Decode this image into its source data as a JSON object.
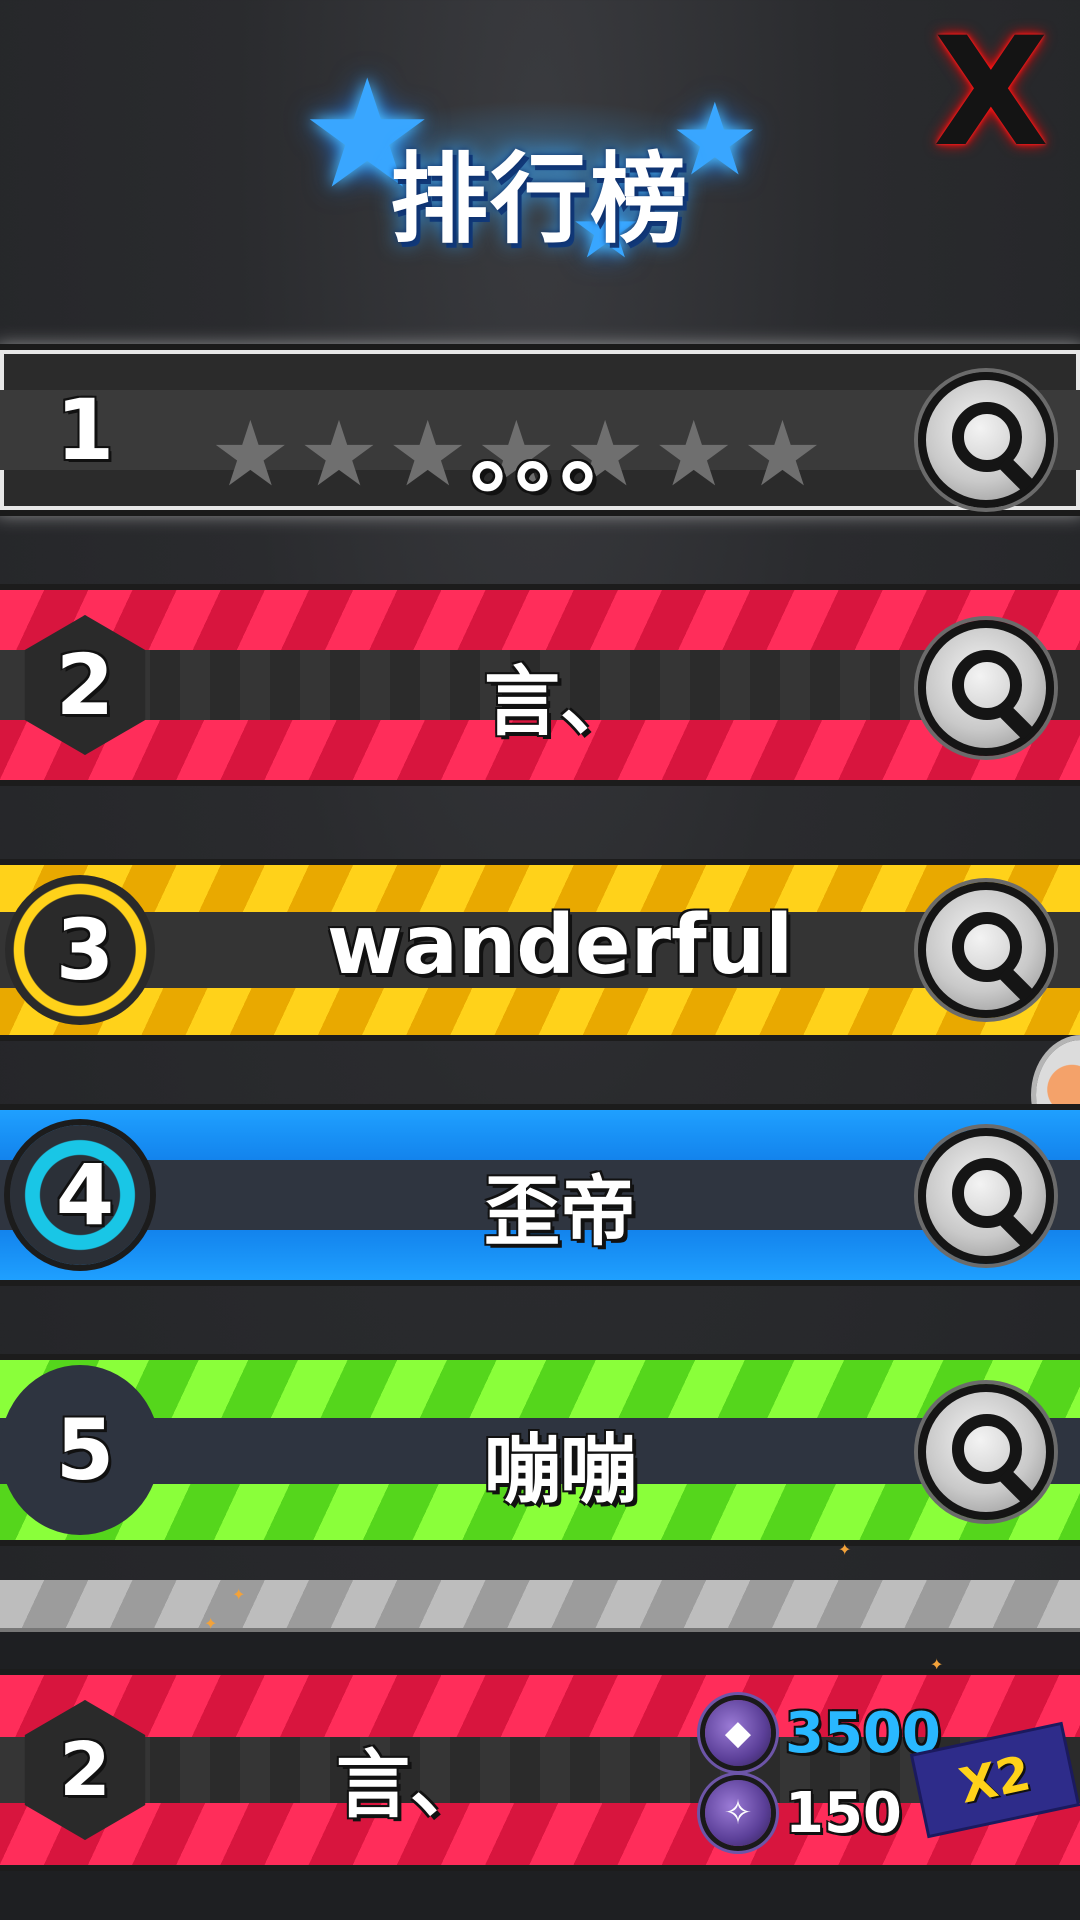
{
  "header": {
    "title": "排行榜",
    "close_label": "X"
  },
  "leaderboard": [
    {
      "rank": "1",
      "name": "。。。",
      "tier_color": "#e8e8e8"
    },
    {
      "rank": "2",
      "name": "言、",
      "tier_color": "#ff2d5a"
    },
    {
      "rank": "3",
      "name": "wanderful",
      "tier_color": "#ffd21a"
    },
    {
      "rank": "4",
      "name": "歪帝",
      "tier_color": "#1fa0ff"
    },
    {
      "rank": "5",
      "name": "嘣嘣",
      "tier_color": "#8aff3a"
    }
  ],
  "own_entry": {
    "rank": "2",
    "name": "言、",
    "score": "3500",
    "gems": "150",
    "multiplier": "X2"
  },
  "icons": {
    "search": "search-icon",
    "close": "close-icon",
    "score": "score-coin-icon",
    "gem": "gem-coin-icon"
  },
  "colors": {
    "score": "#29b8ff",
    "multiplier": "#ffd21a",
    "title_glow": "#3aa8ff"
  }
}
